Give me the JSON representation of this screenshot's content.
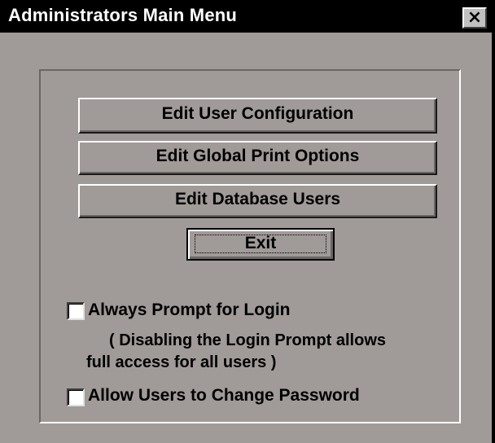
{
  "window": {
    "title": "Administrators Main Menu",
    "close_glyph": "×",
    "close_icon": "close-icon"
  },
  "buttons": {
    "edit_user_config": "Edit User Configuration",
    "edit_global_print": "Edit Global Print Options",
    "edit_database_users": "Edit Database Users",
    "exit": "Exit"
  },
  "options": {
    "always_prompt_login": {
      "label": "Always Prompt for Login",
      "checked": false
    },
    "login_note_line1": "( Disabling the Login Prompt allows",
    "login_note_line2": "full access for all users )",
    "allow_change_password": {
      "label": "Allow Users to Change Password",
      "checked": false
    }
  },
  "colors": {
    "face": "#a09a98",
    "titlebar": "#000000",
    "title_text": "#ffffff"
  }
}
